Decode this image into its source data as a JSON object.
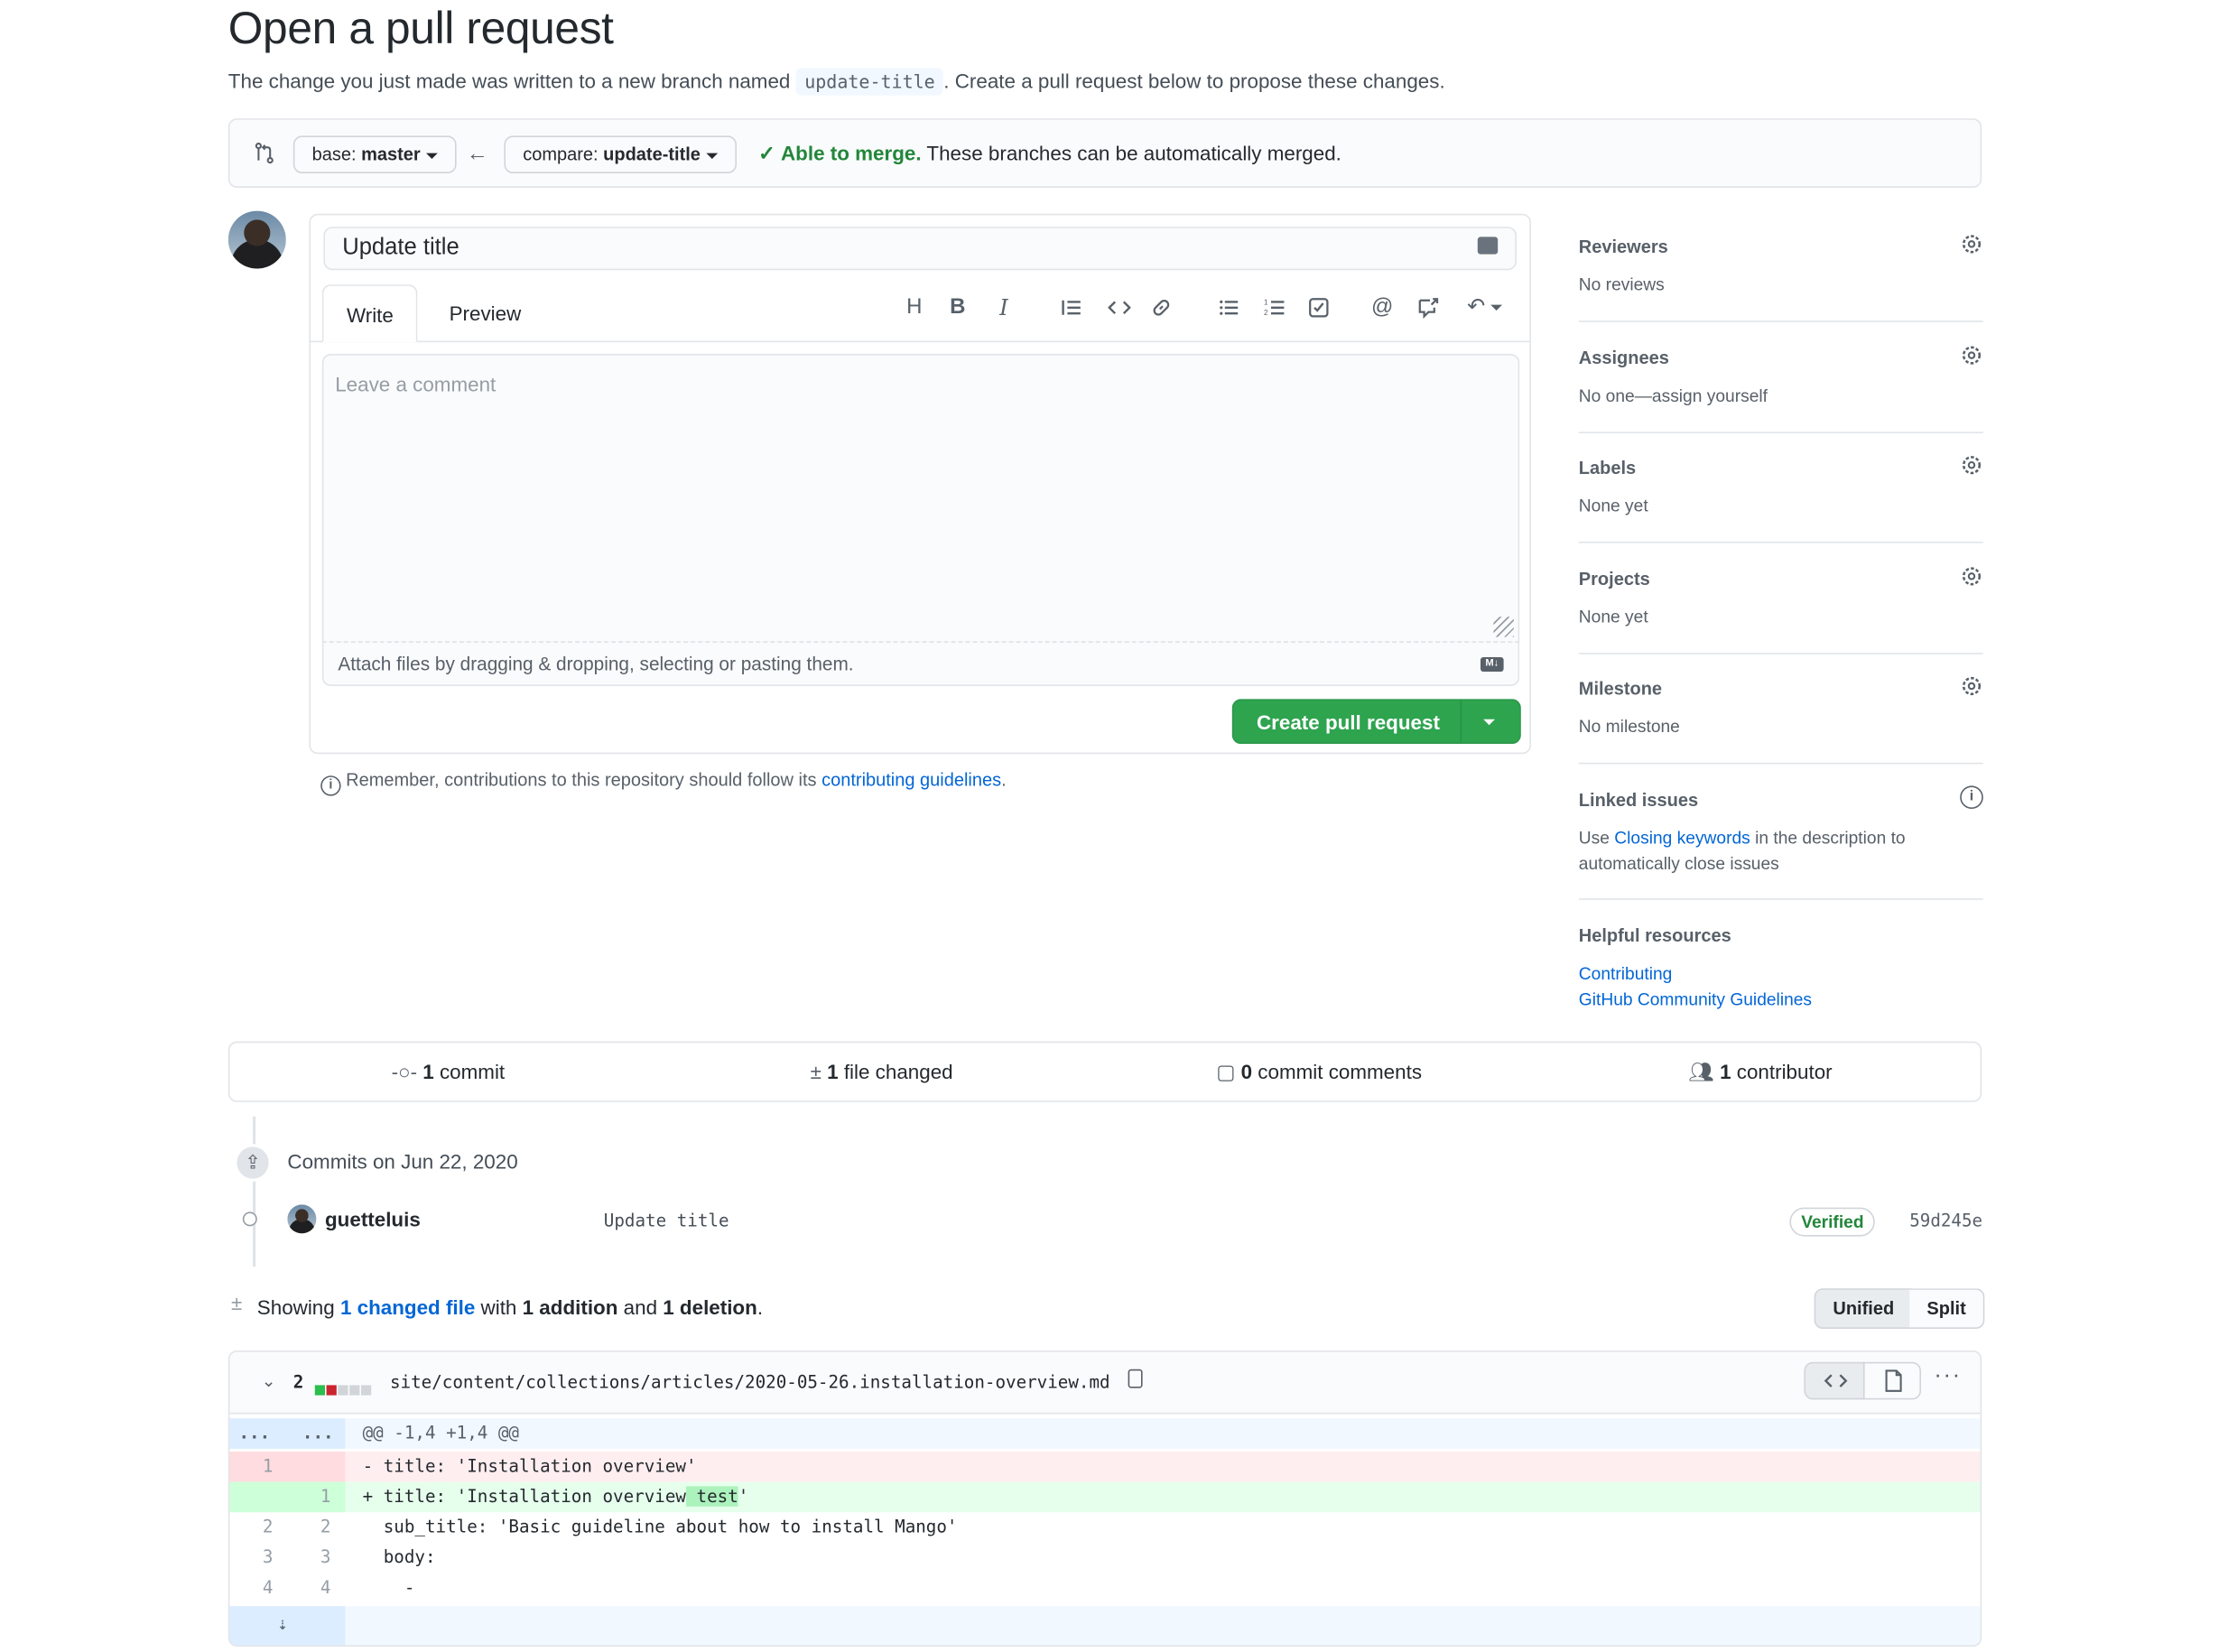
{
  "header": {
    "title": "Open a pull request",
    "subtitle_before": "The change you just made was written to a new branch named ",
    "branch_name": "update-title",
    "subtitle_after": ". Create a pull request below to propose these changes."
  },
  "range": {
    "base_label": "base: ",
    "base_value": "master",
    "compare_label": "compare: ",
    "compare_value": "update-title",
    "merge_status": "Able to merge.",
    "merge_message": " These branches can be automatically merged."
  },
  "composer": {
    "title_value": "Update title",
    "tabs": [
      "Write",
      "Preview"
    ],
    "placeholder": "Leave a comment",
    "attach_text": "Attach files by dragging & dropping, selecting or pasting them.",
    "create_button": "Create pull request",
    "note_before": "Remember, contributions to this repository should follow its ",
    "note_link": "contributing guidelines",
    "note_after": "."
  },
  "sidebar": {
    "reviewers": {
      "heading": "Reviewers",
      "value": "No reviews"
    },
    "assignees": {
      "heading": "Assignees",
      "value": "No one—assign yourself"
    },
    "labels": {
      "heading": "Labels",
      "value": "None yet"
    },
    "projects": {
      "heading": "Projects",
      "value": "None yet"
    },
    "milestone": {
      "heading": "Milestone",
      "value": "No milestone"
    },
    "linked_issues": {
      "heading": "Linked issues",
      "before": "Use ",
      "link": "Closing keywords",
      "after": " in the description to automatically close issues"
    },
    "resources": {
      "heading": "Helpful resources",
      "links": [
        "Contributing",
        "GitHub Community Guidelines"
      ]
    }
  },
  "stats": {
    "commits_count": "1",
    "commits_label": " commit",
    "files_count": "1",
    "files_label": " file changed",
    "comments_count": "0",
    "comments_label": " commit comments",
    "contributors_count": "1",
    "contributors_label": " contributor"
  },
  "commits": {
    "date_heading": "Commits on Jun 22, 2020",
    "author": "guetteluis",
    "message": "Update title",
    "badge": "Verified",
    "sha": "59d245e"
  },
  "diff_summary": {
    "showing": "Showing ",
    "changed_link": "1 changed file",
    "with": " with ",
    "additions": "1 addition",
    "and": " and ",
    "deletions": "1 deletion",
    "end": ".",
    "unified": "Unified",
    "split": "Split"
  },
  "file": {
    "change_count": "2",
    "path": "site/content/collections/articles/2020-05-26.installation-overview.md",
    "hunk_old_marker": "...",
    "hunk_new_marker": "...",
    "hunk_header": "@@ -1,4 +1,4 @@",
    "lines": [
      {
        "old": "1",
        "new": "",
        "text": "- title: 'Installation overview'",
        "type": "del"
      },
      {
        "old": "",
        "new": "1",
        "text_before": "+ title: 'Installation overview",
        "text_hl": " test",
        "text_after": "'",
        "type": "add"
      },
      {
        "old": "2",
        "new": "2",
        "text": "  sub_title: 'Basic guideline about how to install Mango'",
        "type": "ctx"
      },
      {
        "old": "3",
        "new": "3",
        "text": "  body:",
        "type": "ctx"
      },
      {
        "old": "4",
        "new": "4",
        "text": "    -",
        "type": "ctx"
      }
    ]
  },
  "colors": {
    "green_button": "#2ea44f",
    "link": "#0366d6",
    "merge_ok": "#22863a",
    "deletion_bg": "#ffeef0",
    "addition_bg": "#e6ffed"
  }
}
